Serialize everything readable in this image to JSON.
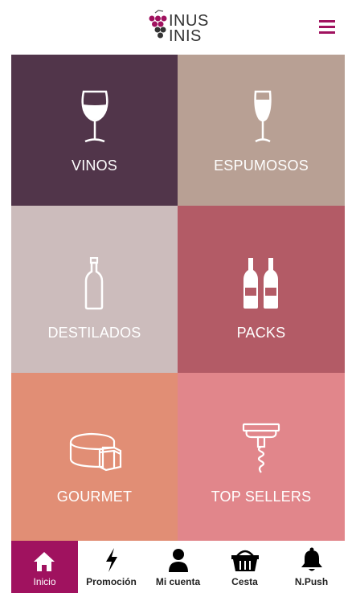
{
  "header": {
    "logo_line1": "INUS",
    "logo_line2": "INIS",
    "menu_icon": "hamburger-menu-icon",
    "brand_color": "#a0125f"
  },
  "categories": [
    {
      "label": "VINOS",
      "color": "#51354a",
      "icon": "red-wine-glass-icon"
    },
    {
      "label": "ESPUMOSOS",
      "color": "#b8a094",
      "icon": "champagne-flute-icon"
    },
    {
      "label": "DESTILADOS",
      "color": "#ccbcbc",
      "icon": "spirit-bottle-icon"
    },
    {
      "label": "PACKS",
      "color": "#b35b66",
      "icon": "two-bottles-icon"
    },
    {
      "label": "GOURMET",
      "color": "#e18e75",
      "icon": "cheese-icon"
    },
    {
      "label": "TOP SELLERS",
      "color": "#e1868b",
      "icon": "corkscrew-icon"
    }
  ],
  "tabbar": {
    "items": [
      {
        "label": "Inicio",
        "icon": "home-icon",
        "active": true
      },
      {
        "label": "Promoción",
        "icon": "lightning-bolt-icon",
        "active": false
      },
      {
        "label": "Mi cuenta",
        "icon": "user-icon",
        "active": false
      },
      {
        "label": "Cesta",
        "icon": "basket-icon",
        "active": false
      },
      {
        "label": "N.Push",
        "icon": "bell-icon",
        "active": false
      }
    ],
    "active_color": "#a0125f"
  }
}
